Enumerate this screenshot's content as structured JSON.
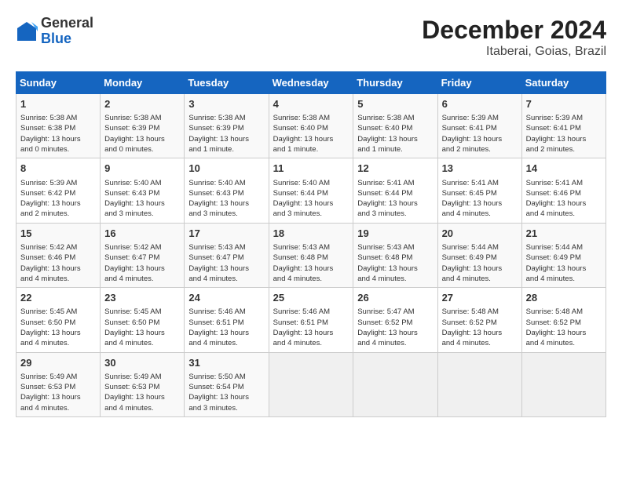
{
  "header": {
    "logo_general": "General",
    "logo_blue": "Blue",
    "month_title": "December 2024",
    "subtitle": "Itaberai, Goias, Brazil"
  },
  "days_of_week": [
    "Sunday",
    "Monday",
    "Tuesday",
    "Wednesday",
    "Thursday",
    "Friday",
    "Saturday"
  ],
  "weeks": [
    [
      {
        "day": "1",
        "info": "Sunrise: 5:38 AM\nSunset: 6:38 PM\nDaylight: 13 hours\nand 0 minutes."
      },
      {
        "day": "2",
        "info": "Sunrise: 5:38 AM\nSunset: 6:39 PM\nDaylight: 13 hours\nand 0 minutes."
      },
      {
        "day": "3",
        "info": "Sunrise: 5:38 AM\nSunset: 6:39 PM\nDaylight: 13 hours\nand 1 minute."
      },
      {
        "day": "4",
        "info": "Sunrise: 5:38 AM\nSunset: 6:40 PM\nDaylight: 13 hours\nand 1 minute."
      },
      {
        "day": "5",
        "info": "Sunrise: 5:38 AM\nSunset: 6:40 PM\nDaylight: 13 hours\nand 1 minute."
      },
      {
        "day": "6",
        "info": "Sunrise: 5:39 AM\nSunset: 6:41 PM\nDaylight: 13 hours\nand 2 minutes."
      },
      {
        "day": "7",
        "info": "Sunrise: 5:39 AM\nSunset: 6:41 PM\nDaylight: 13 hours\nand 2 minutes."
      }
    ],
    [
      {
        "day": "8",
        "info": "Sunrise: 5:39 AM\nSunset: 6:42 PM\nDaylight: 13 hours\nand 2 minutes."
      },
      {
        "day": "9",
        "info": "Sunrise: 5:40 AM\nSunset: 6:43 PM\nDaylight: 13 hours\nand 3 minutes."
      },
      {
        "day": "10",
        "info": "Sunrise: 5:40 AM\nSunset: 6:43 PM\nDaylight: 13 hours\nand 3 minutes."
      },
      {
        "day": "11",
        "info": "Sunrise: 5:40 AM\nSunset: 6:44 PM\nDaylight: 13 hours\nand 3 minutes."
      },
      {
        "day": "12",
        "info": "Sunrise: 5:41 AM\nSunset: 6:44 PM\nDaylight: 13 hours\nand 3 minutes."
      },
      {
        "day": "13",
        "info": "Sunrise: 5:41 AM\nSunset: 6:45 PM\nDaylight: 13 hours\nand 4 minutes."
      },
      {
        "day": "14",
        "info": "Sunrise: 5:41 AM\nSunset: 6:46 PM\nDaylight: 13 hours\nand 4 minutes."
      }
    ],
    [
      {
        "day": "15",
        "info": "Sunrise: 5:42 AM\nSunset: 6:46 PM\nDaylight: 13 hours\nand 4 minutes."
      },
      {
        "day": "16",
        "info": "Sunrise: 5:42 AM\nSunset: 6:47 PM\nDaylight: 13 hours\nand 4 minutes."
      },
      {
        "day": "17",
        "info": "Sunrise: 5:43 AM\nSunset: 6:47 PM\nDaylight: 13 hours\nand 4 minutes."
      },
      {
        "day": "18",
        "info": "Sunrise: 5:43 AM\nSunset: 6:48 PM\nDaylight: 13 hours\nand 4 minutes."
      },
      {
        "day": "19",
        "info": "Sunrise: 5:43 AM\nSunset: 6:48 PM\nDaylight: 13 hours\nand 4 minutes."
      },
      {
        "day": "20",
        "info": "Sunrise: 5:44 AM\nSunset: 6:49 PM\nDaylight: 13 hours\nand 4 minutes."
      },
      {
        "day": "21",
        "info": "Sunrise: 5:44 AM\nSunset: 6:49 PM\nDaylight: 13 hours\nand 4 minutes."
      }
    ],
    [
      {
        "day": "22",
        "info": "Sunrise: 5:45 AM\nSunset: 6:50 PM\nDaylight: 13 hours\nand 4 minutes."
      },
      {
        "day": "23",
        "info": "Sunrise: 5:45 AM\nSunset: 6:50 PM\nDaylight: 13 hours\nand 4 minutes."
      },
      {
        "day": "24",
        "info": "Sunrise: 5:46 AM\nSunset: 6:51 PM\nDaylight: 13 hours\nand 4 minutes."
      },
      {
        "day": "25",
        "info": "Sunrise: 5:46 AM\nSunset: 6:51 PM\nDaylight: 13 hours\nand 4 minutes."
      },
      {
        "day": "26",
        "info": "Sunrise: 5:47 AM\nSunset: 6:52 PM\nDaylight: 13 hours\nand 4 minutes."
      },
      {
        "day": "27",
        "info": "Sunrise: 5:48 AM\nSunset: 6:52 PM\nDaylight: 13 hours\nand 4 minutes."
      },
      {
        "day": "28",
        "info": "Sunrise: 5:48 AM\nSunset: 6:52 PM\nDaylight: 13 hours\nand 4 minutes."
      }
    ],
    [
      {
        "day": "29",
        "info": "Sunrise: 5:49 AM\nSunset: 6:53 PM\nDaylight: 13 hours\nand 4 minutes."
      },
      {
        "day": "30",
        "info": "Sunrise: 5:49 AM\nSunset: 6:53 PM\nDaylight: 13 hours\nand 4 minutes."
      },
      {
        "day": "31",
        "info": "Sunrise: 5:50 AM\nSunset: 6:54 PM\nDaylight: 13 hours\nand 3 minutes."
      },
      {
        "day": "",
        "info": ""
      },
      {
        "day": "",
        "info": ""
      },
      {
        "day": "",
        "info": ""
      },
      {
        "day": "",
        "info": ""
      }
    ]
  ]
}
